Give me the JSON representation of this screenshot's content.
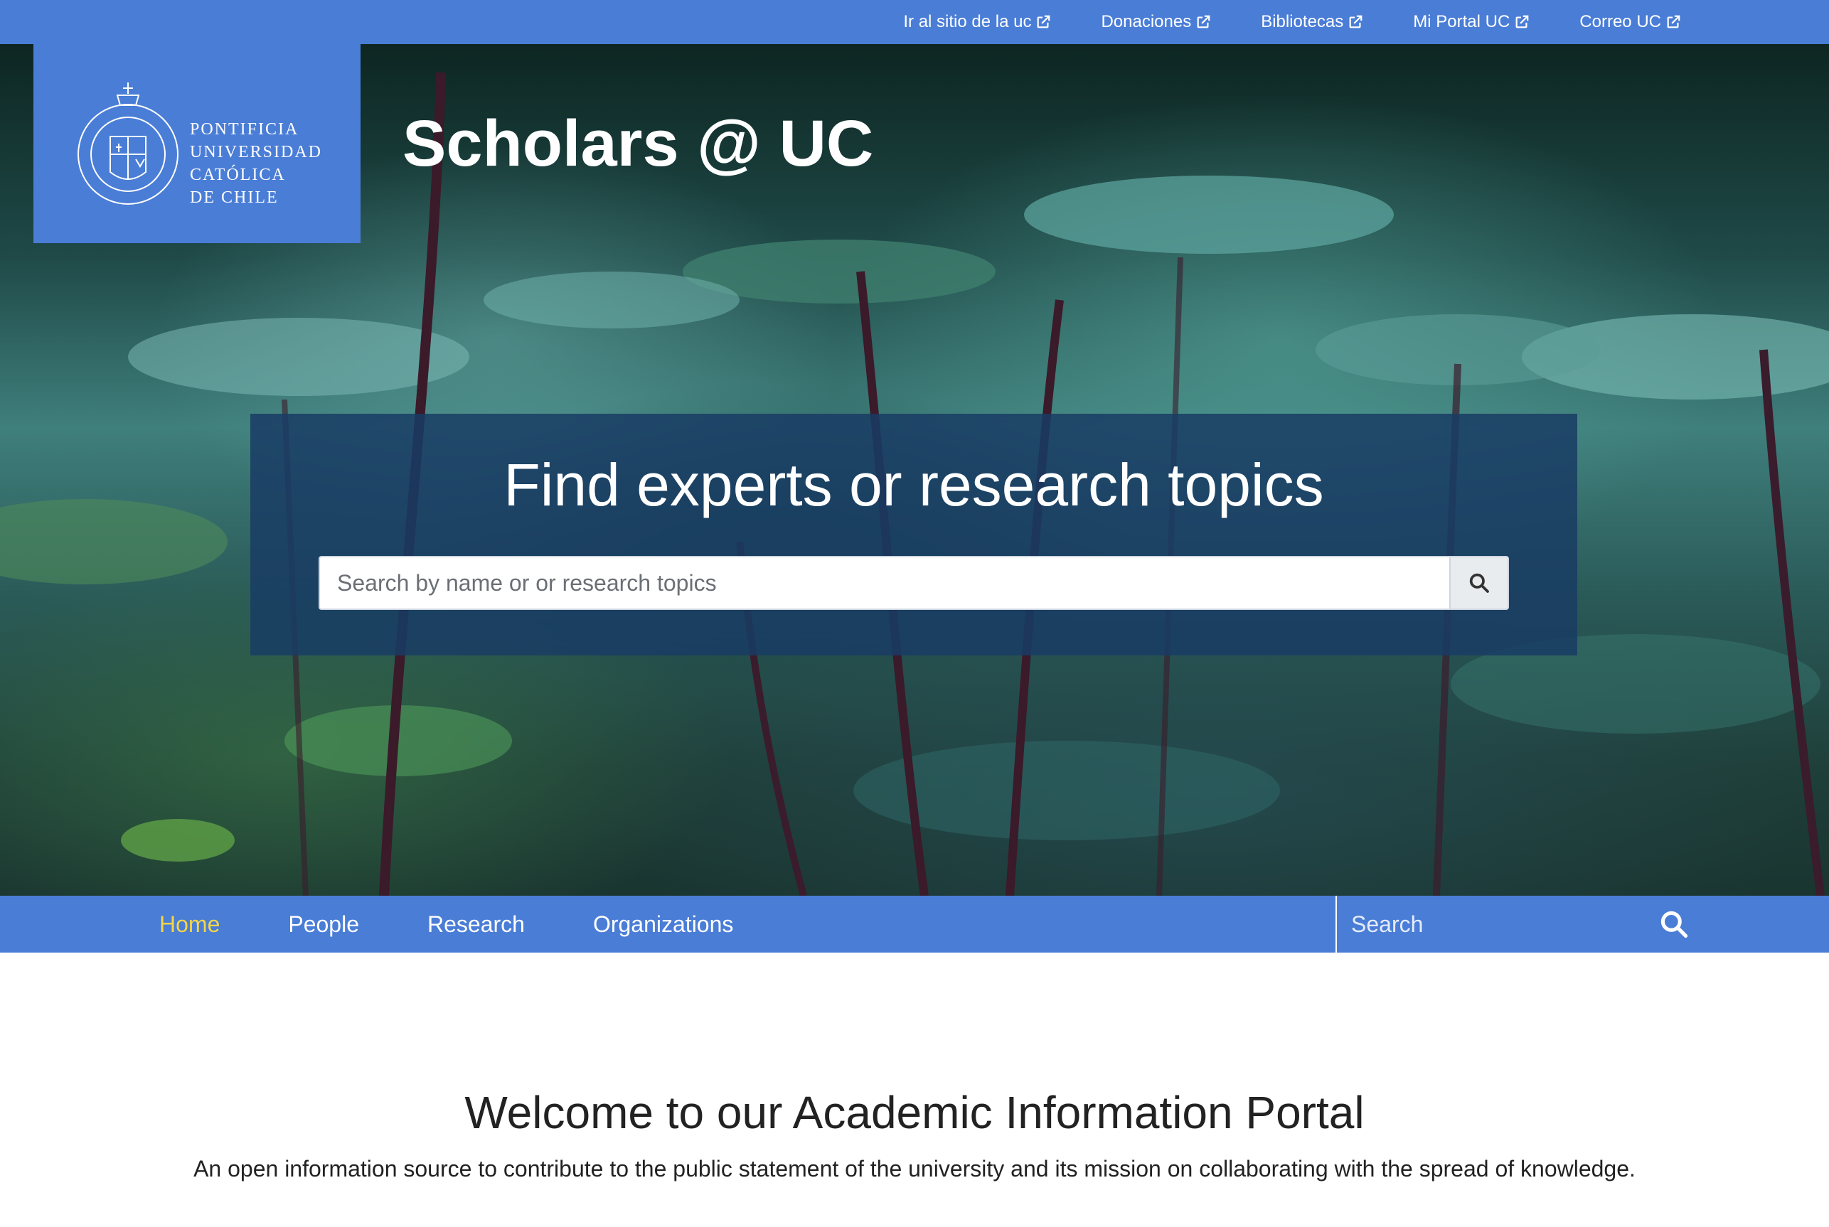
{
  "top_links": [
    {
      "label": "Ir al sitio de la uc",
      "icon": "external-link-icon"
    },
    {
      "label": "Donaciones",
      "icon": "external-link-icon"
    },
    {
      "label": "Bibliotecas",
      "icon": "external-link-icon"
    },
    {
      "label": "Mi Portal UC",
      "icon": "external-link-icon"
    },
    {
      "label": "Correo UC",
      "icon": "external-link-icon"
    }
  ],
  "logo": {
    "lines": [
      "PONTIFICIA",
      "UNIVERSIDAD",
      "CATÓLICA",
      "DE CHILE"
    ],
    "seal_text_top": "UNIVERSIDAD",
    "seal_text_bottom": "DE CHILE"
  },
  "site_title": "Scholars @ UC",
  "hero_search": {
    "heading": "Find experts or research topics",
    "placeholder": "Search by name or or research topics",
    "button_icon": "search-icon"
  },
  "nav": {
    "items": [
      {
        "label": "Home",
        "active": true
      },
      {
        "label": "People",
        "active": false
      },
      {
        "label": "Research",
        "active": false
      },
      {
        "label": "Organizations",
        "active": false
      }
    ],
    "search_placeholder": "Search",
    "search_icon": "search-icon"
  },
  "welcome": {
    "title": "Welcome to our Academic Information Portal",
    "subtitle": "An open information source to contribute to the public statement of the university and its mission on collaborating with the spread of knowledge."
  },
  "colors": {
    "brand_blue": "#4a7dd6",
    "active_nav": "#f5d547",
    "panel": "#193c64"
  }
}
